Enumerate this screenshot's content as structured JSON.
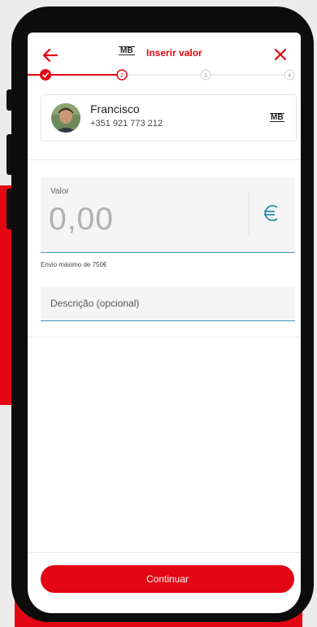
{
  "header": {
    "title": "Inserir valor",
    "logo": "MB",
    "back_icon": "arrow-left-icon",
    "close_icon": "close-icon"
  },
  "stepper": {
    "steps": [
      "✓",
      "2",
      "3",
      "4"
    ],
    "current": 2
  },
  "contact": {
    "name": "Francisco",
    "phone": "+351 921 773 212",
    "badge": "MB"
  },
  "amount": {
    "label": "Valor",
    "value": "0,00",
    "currency_icon": "euro-icon",
    "limit_text": "Envio máximo de 750€"
  },
  "description": {
    "placeholder": "Descrição (opcional)"
  },
  "footer": {
    "continue_label": "Continuar"
  },
  "colors": {
    "accent": "#e30613",
    "input_border": "#3e9bb8",
    "placeholder": "#b0b0b0"
  }
}
